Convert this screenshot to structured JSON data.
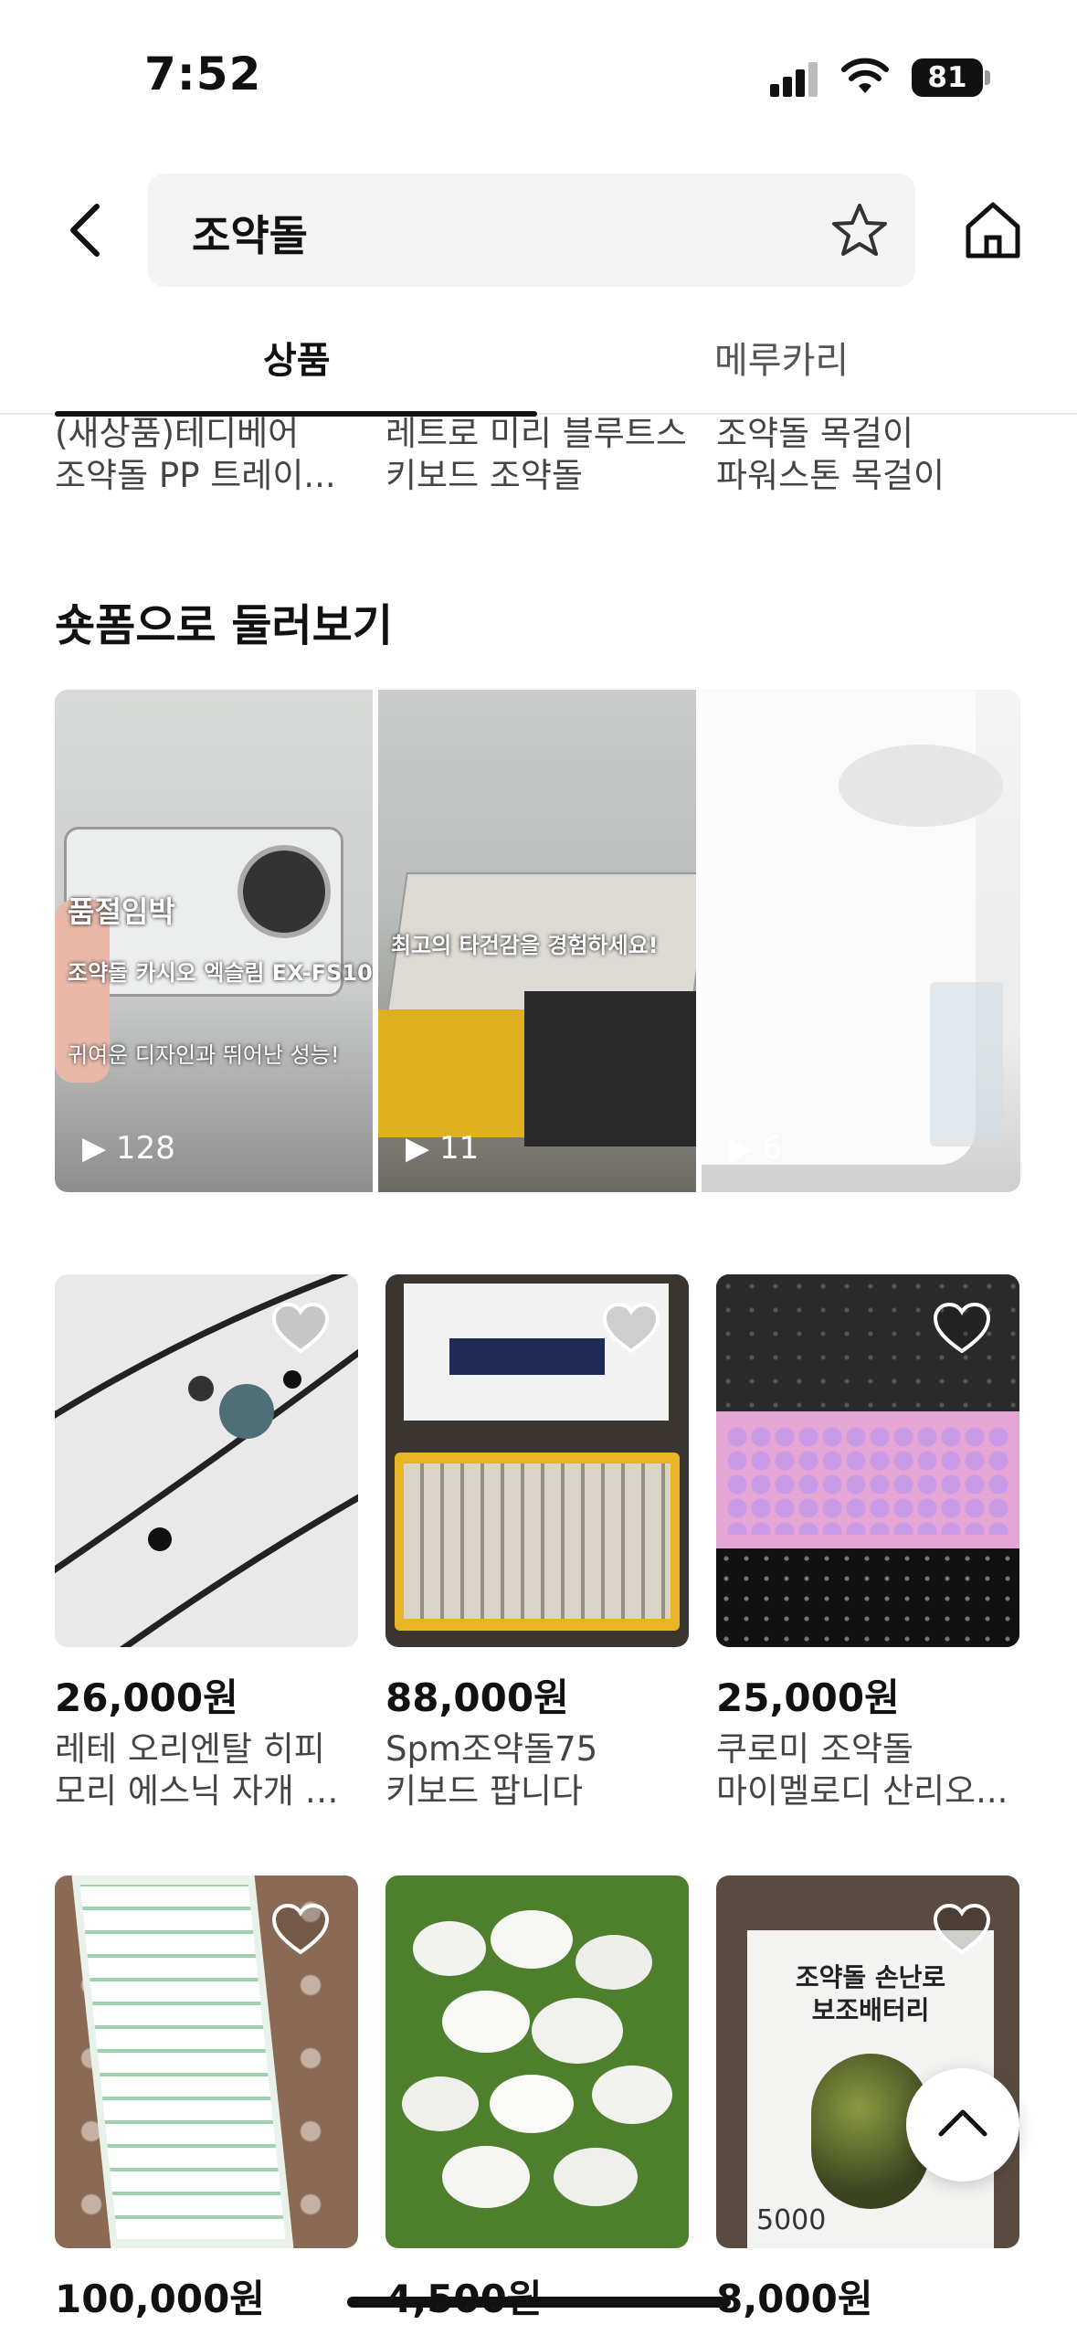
{
  "status_bar": {
    "time": "7:52",
    "battery": "81"
  },
  "header": {
    "search_query": "조약돌"
  },
  "tabs": [
    {
      "label": "상품"
    },
    {
      "label": "메루카리"
    }
  ],
  "suggested_items": [
    {
      "line1": "(새상품)테디베어",
      "line2": "조약돌 PP 트레이..."
    },
    {
      "line1": "레트로 미리 블루트스",
      "line2": "키보드 조약돌"
    },
    {
      "line1": "조약돌 목걸이",
      "line2": "파워스톤 목걸이"
    }
  ],
  "shortform": {
    "title": "숏폼으로 둘러보기",
    "cards": [
      {
        "views": "128",
        "caption_top": "품절임박",
        "caption_mid": "조약돌 카시오 엑슬림 EX-FS10",
        "caption_bottom": "귀여운 디자인과 뛰어난 성능!"
      },
      {
        "views": "11",
        "caption_mid": "최고의 타건감을 경험하세요!"
      },
      {
        "views": "6"
      }
    ]
  },
  "products": [
    {
      "price": "26,000원",
      "name1": "레테 오리엔탈 히피",
      "name2": "모리 에스닉 자개 조..."
    },
    {
      "price": "88,000원",
      "name1": "Spm조약돌75",
      "name2": "키보드 팝니다"
    },
    {
      "price": "25,000원",
      "name1": "쿠로미 조약돌",
      "name2": "마이멜로디 산리오..."
    },
    {
      "price": "100,000원",
      "name1": "",
      "name2": ""
    },
    {
      "price": "4,500원",
      "name1": "",
      "name2": ""
    },
    {
      "price": "8,000원",
      "name1": "",
      "name2": ""
    }
  ],
  "product_box_text": {
    "line1": "조약돌 손난로",
    "line2": "보조배터리",
    "capacity": "5000"
  },
  "colors": {
    "accent": "#111111",
    "search_bg": "#f4f4f5"
  }
}
